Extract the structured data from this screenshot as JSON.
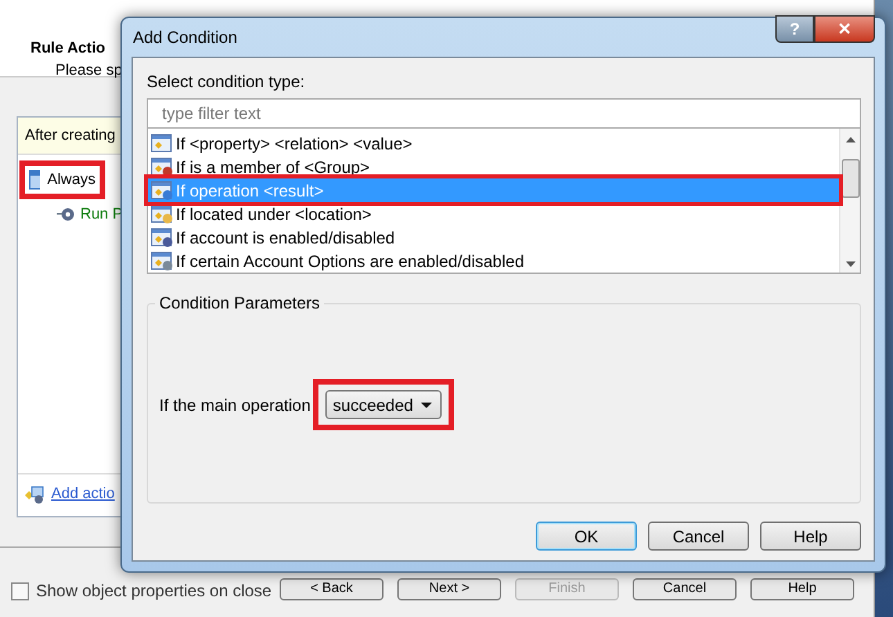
{
  "wizard": {
    "title": "Rule Actio",
    "subtitle": "Please sp",
    "panel_header": "After creating",
    "tree": [
      {
        "label": "Always",
        "highlighted": true,
        "children": [
          {
            "label": "Run P"
          }
        ]
      }
    ],
    "add_link": "Add actio",
    "checkbox": {
      "label": "Show object properties on close",
      "checked": false
    },
    "buttons": [
      {
        "label": "< Back",
        "disabled": false
      },
      {
        "label": "Next >",
        "disabled": false
      },
      {
        "label": "Finish",
        "disabled": true
      },
      {
        "label": "Cancel",
        "disabled": false
      },
      {
        "label": "Help",
        "disabled": false
      }
    ]
  },
  "dialog": {
    "title": "Add Condition",
    "help_button": "?",
    "close_button": "✕",
    "list_label": "Select condition type:",
    "filter": {
      "placeholder": "type filter text"
    },
    "conditions": [
      {
        "label": "If <property> <relation> <value>",
        "kind": "property",
        "selected": false,
        "highlighted": false
      },
      {
        "label": "If is a member of <Group>",
        "kind": "group",
        "selected": false,
        "highlighted": false
      },
      {
        "label": "If operation <result>",
        "kind": "operation",
        "selected": true,
        "highlighted": true
      },
      {
        "label": "If located under <location>",
        "kind": "location",
        "selected": false,
        "highlighted": false
      },
      {
        "label": "If account is enabled/disabled",
        "kind": "account",
        "selected": false,
        "highlighted": false
      },
      {
        "label": "If certain Account Options are enabled/disabled",
        "kind": "options",
        "selected": false,
        "highlighted": false
      }
    ],
    "params_title": "Condition Parameters",
    "param_label": "If the main operation",
    "result": {
      "value": "succeeded",
      "highlighted": true
    },
    "buttons": [
      {
        "label": "OK",
        "default": true
      },
      {
        "label": "Cancel",
        "default": false
      },
      {
        "label": "Help",
        "default": false
      }
    ]
  }
}
